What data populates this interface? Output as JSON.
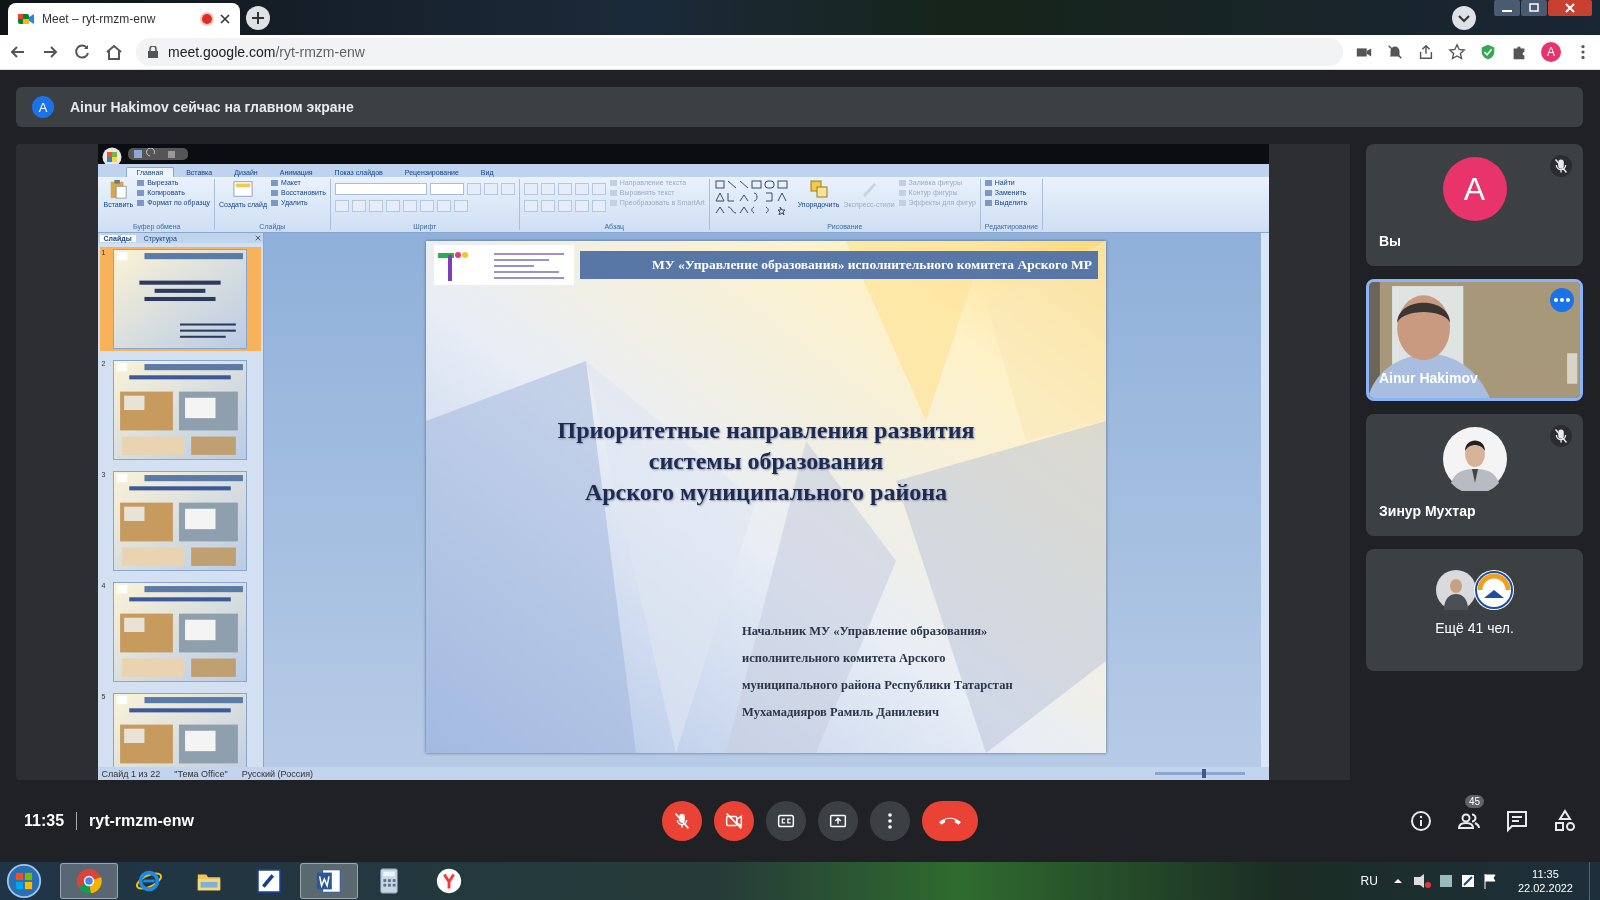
{
  "browser": {
    "tab": {
      "title": "Meet – ryt-rmzm-enw",
      "recording": true
    },
    "url": {
      "host": "meet.google.com",
      "path": "/ryt-rmzm-enw"
    },
    "profile_initial": "A"
  },
  "banner": {
    "initial": "A",
    "text": "Ainur Hakimov сейчас на главном экране"
  },
  "presentation": {
    "ribbon_tabs": [
      {
        "label": "Главная",
        "selected": true
      },
      {
        "label": "Вставка",
        "selected": false
      },
      {
        "label": "Дизайн",
        "selected": false
      },
      {
        "label": "Анимация",
        "selected": false
      },
      {
        "label": "Показ слайдов",
        "selected": false
      },
      {
        "label": "Рецензирование",
        "selected": false
      },
      {
        "label": "Вид",
        "selected": false
      }
    ],
    "groups": [
      {
        "kind": "clipboard",
        "label": "Буфер обмена",
        "big": "Вставить",
        "items": [
          {
            "label": "Вырезать",
            "disabled": false
          },
          {
            "label": "Копировать",
            "disabled": false
          },
          {
            "label": "Формат по образцу",
            "disabled": false
          }
        ]
      },
      {
        "kind": "slides",
        "label": "Слайды",
        "big": "Создать слайд",
        "items": [
          {
            "label": "Макет",
            "disabled": false
          },
          {
            "label": "Восстановить",
            "disabled": false
          },
          {
            "label": "Удалить",
            "disabled": false
          }
        ]
      },
      {
        "kind": "font",
        "label": "Шрифт"
      },
      {
        "kind": "paragraph",
        "label": "Абзац",
        "items": [
          {
            "label": "Направление текста",
            "disabled": true
          },
          {
            "label": "Выровнять текст",
            "disabled": true
          },
          {
            "label": "Преобразовать в SmartArt",
            "disabled": true
          }
        ]
      },
      {
        "kind": "drawing",
        "label": "Рисование",
        "big": "Упорядочить",
        "big2": "Экспресс-стили",
        "items": [
          {
            "label": "Заливка фигуры",
            "disabled": true
          },
          {
            "label": "Контур фигуры",
            "disabled": true
          },
          {
            "label": "Эффекты для фигур",
            "disabled": true
          }
        ]
      },
      {
        "kind": "editing",
        "label": "Редактирование",
        "items": [
          {
            "label": "Найти",
            "disabled": false
          },
          {
            "label": "Заменить",
            "disabled": false
          },
          {
            "label": "Выделить",
            "disabled": false
          }
        ]
      }
    ],
    "pane_tabs": [
      {
        "label": "Слайды",
        "selected": true
      },
      {
        "label": "Структура",
        "selected": false
      }
    ],
    "thumbnails": [
      {
        "number": "1",
        "selected": true,
        "kind": "title"
      },
      {
        "number": "2",
        "selected": false,
        "kind": "photos"
      },
      {
        "number": "3",
        "selected": false,
        "kind": "photos"
      },
      {
        "number": "4",
        "selected": false,
        "kind": "photos"
      },
      {
        "number": "5",
        "selected": false,
        "kind": "photos"
      }
    ],
    "slide": {
      "header": "МУ «Управление образования» исполнительного комитета Арского МР",
      "title_lines": [
        "Приоритетные направления развития",
        "системы образования",
        "Арского муниципального района"
      ],
      "author_lines": [
        "Начальник МУ «Управление образования»",
        "исполнительного комитета Арского",
        "муниципального района Республики Татарстан",
        "Мухамадияров Рамиль Данилевич"
      ]
    },
    "status": [
      "Слайд 1 из 22",
      "\"Тема Office\"",
      "Русский (Россия)"
    ],
    "zoom": {
      "level": 0.55
    }
  },
  "participants": [
    {
      "kind": "initial",
      "name": "Вы",
      "initial": "A",
      "muted": true,
      "selected": false
    },
    {
      "kind": "video",
      "name": "Ainur Hakimov",
      "muted": false,
      "selected": true
    },
    {
      "name": "Зинур Мухтар",
      "muted": true,
      "selected": false
    },
    {
      "kind": "more",
      "name": "Ещё 41 чел.",
      "muted": false,
      "selected": false
    }
  ],
  "controls": {
    "time": "11:35",
    "meeting_code": "ryt-rmzm-enw",
    "buttons": [
      {
        "kind": "mic",
        "on": false
      },
      {
        "kind": "camera",
        "on": false
      },
      {
        "kind": "captions"
      },
      {
        "kind": "present"
      },
      {
        "kind": "more"
      },
      {
        "kind": "leave"
      }
    ],
    "people_count": "45"
  },
  "taskbar": {
    "apps": [
      {
        "kind": "chrome",
        "active": true
      },
      {
        "kind": "ie",
        "active": false
      },
      {
        "kind": "folder",
        "active": false
      },
      {
        "kind": "phone",
        "active": false
      },
      {
        "kind": "word",
        "active": true
      },
      {
        "kind": "calculator",
        "active": false
      },
      {
        "kind": "yandex",
        "active": false
      }
    ],
    "language": "RU",
    "time": "11:35",
    "date": "22.02.2022"
  }
}
